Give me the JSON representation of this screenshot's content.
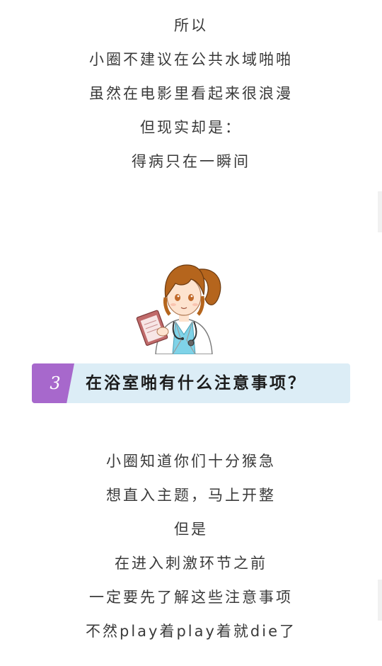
{
  "top_text": {
    "lines": [
      "所以",
      "小圈不建议在公共水域啪啪",
      "虽然在电影里看起来很浪漫",
      "但现实却是：",
      "得病只在一瞬间"
    ]
  },
  "section": {
    "number": "3",
    "title": "在浴室啪有什么注意事项？"
  },
  "bottom_text": {
    "lines": [
      "小圈知道你们十分猴急",
      "想直入主题，马上开整",
      "但是",
      "在进入刺激环节之前",
      "一定要先了解这些注意事项",
      "不然play着play着就die了"
    ]
  },
  "illustration": {
    "icon": "doctor-girl-icon",
    "colors": {
      "hair": "#b5651d",
      "coat": "#ffffff",
      "shirt": "#7fd3e8",
      "clipboard": "#c06a6a"
    }
  },
  "colors": {
    "text": "#3a3a3a",
    "heading_bar": "#dcedf6",
    "heading_tab": "#a768cc",
    "heading_text": "#1c1c1c"
  }
}
